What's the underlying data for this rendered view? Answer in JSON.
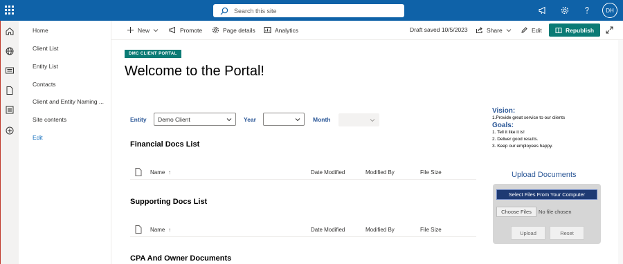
{
  "suitebar": {
    "search_placeholder": "Search this site",
    "avatar_initials": "DH"
  },
  "leftnav": {
    "items": [
      {
        "label": "Home"
      },
      {
        "label": "Client List"
      },
      {
        "label": "Entity List"
      },
      {
        "label": "Contacts"
      },
      {
        "label": "Client and Entity Naming ..."
      },
      {
        "label": "Site contents"
      },
      {
        "label": "Edit"
      }
    ]
  },
  "commandbar": {
    "new_label": "New",
    "promote_label": "Promote",
    "page_details_label": "Page details",
    "analytics_label": "Analytics",
    "draft_status": "Draft saved 10/5/2023",
    "share_label": "Share",
    "edit_label": "Edit",
    "republish_label": "Republish"
  },
  "page": {
    "badge": "DMC CLIENT PORTAL",
    "title": "Welcome to the Portal!"
  },
  "filters": {
    "entity_label": "Entity",
    "entity_value": "Demo Client",
    "year_label": "Year",
    "year_value": "",
    "month_label": "Month",
    "month_value": ""
  },
  "sections": [
    {
      "title": "Financial Docs List",
      "columns": {
        "name": "Name",
        "sort": "↑",
        "date": "Date Modified",
        "by": "Modified By",
        "size": "File Size"
      }
    },
    {
      "title": "Supporting Docs List",
      "columns": {
        "name": "Name",
        "sort": "↑",
        "date": "Date Modified",
        "by": "Modified By",
        "size": "File Size"
      }
    },
    {
      "title": "CPA And Owner Documents"
    }
  ],
  "vision": {
    "vision_heading": "Vision:",
    "vision_text": "1.Provide great service to our clients",
    "goals_heading": "Goals:",
    "goals": [
      "1. Tell it like it is!",
      "2. Deliver good results.",
      "3. Keep our employees happy."
    ]
  },
  "upload": {
    "title": "Upload Documents",
    "select_files": "Select Files From Your Computer",
    "choose_files": "Choose Files",
    "no_file": "No file chosen",
    "upload_btn": "Upload",
    "reset_btn": "Reset"
  },
  "colors": {
    "suitebar": "#0f62a8",
    "accent_teal": "#0b7b75",
    "heading_blue": "#2b5797",
    "select_files_bg": "#1e3a73"
  }
}
